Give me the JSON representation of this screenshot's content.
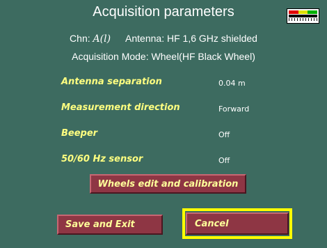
{
  "header": {
    "title": "Acquisition parameters",
    "chn_label": "Chn:",
    "chn_value": "A(l)",
    "antenna": "Antenna: HF 1,6 GHz shielded",
    "mode": "Acquisition Mode: Wheel(HF Black Wheel)"
  },
  "params": [
    {
      "label": "Antenna separation",
      "value": "0.04 m"
    },
    {
      "label": "Measurement direction",
      "value": "Forward"
    },
    {
      "label": "Beeper",
      "value": "Off"
    },
    {
      "label": "50/60 Hz sensor",
      "value": "Off"
    }
  ],
  "buttons": {
    "wheels": "Wheels edit and calibration",
    "save": "Save and Exit",
    "cancel": "Cancel"
  },
  "colors": {
    "background": "#3d6b60",
    "button": "#8e3644",
    "label": "#ffff80",
    "focus": "#ffff00"
  },
  "icons": {
    "indicator": "signal-level-indicator-icon"
  }
}
